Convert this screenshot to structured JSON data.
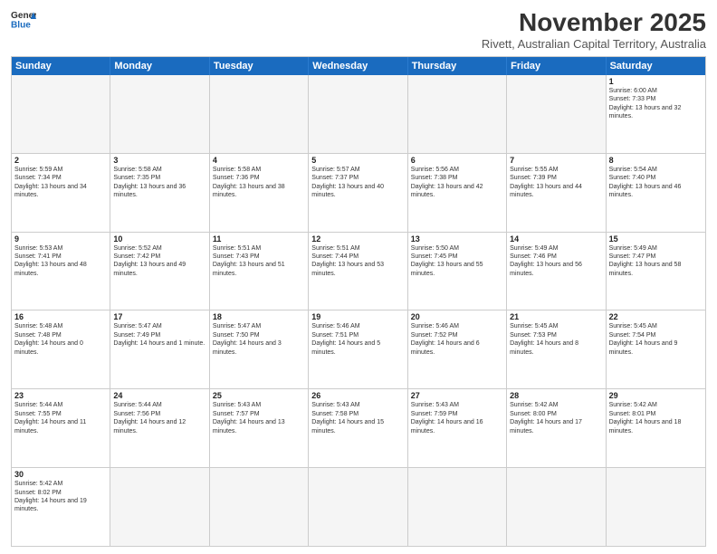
{
  "header": {
    "logo_line1": "General",
    "logo_line2": "Blue",
    "month_title": "November 2025",
    "subtitle": "Rivett, Australian Capital Territory, Australia"
  },
  "days_of_week": [
    "Sunday",
    "Monday",
    "Tuesday",
    "Wednesday",
    "Thursday",
    "Friday",
    "Saturday"
  ],
  "weeks": [
    [
      {
        "day": "",
        "empty": true
      },
      {
        "day": "",
        "empty": true
      },
      {
        "day": "",
        "empty": true
      },
      {
        "day": "",
        "empty": true
      },
      {
        "day": "",
        "empty": true
      },
      {
        "day": "",
        "empty": true
      },
      {
        "day": "1",
        "sunrise": "6:00 AM",
        "sunset": "7:33 PM",
        "daylight": "13 hours and 32 minutes."
      }
    ],
    [
      {
        "day": "2",
        "sunrise": "5:59 AM",
        "sunset": "7:34 PM",
        "daylight": "13 hours and 34 minutes."
      },
      {
        "day": "3",
        "sunrise": "5:58 AM",
        "sunset": "7:35 PM",
        "daylight": "13 hours and 36 minutes."
      },
      {
        "day": "4",
        "sunrise": "5:58 AM",
        "sunset": "7:36 PM",
        "daylight": "13 hours and 38 minutes."
      },
      {
        "day": "5",
        "sunrise": "5:57 AM",
        "sunset": "7:37 PM",
        "daylight": "13 hours and 40 minutes."
      },
      {
        "day": "6",
        "sunrise": "5:56 AM",
        "sunset": "7:38 PM",
        "daylight": "13 hours and 42 minutes."
      },
      {
        "day": "7",
        "sunrise": "5:55 AM",
        "sunset": "7:39 PM",
        "daylight": "13 hours and 44 minutes."
      },
      {
        "day": "8",
        "sunrise": "5:54 AM",
        "sunset": "7:40 PM",
        "daylight": "13 hours and 46 minutes."
      }
    ],
    [
      {
        "day": "9",
        "sunrise": "5:53 AM",
        "sunset": "7:41 PM",
        "daylight": "13 hours and 48 minutes."
      },
      {
        "day": "10",
        "sunrise": "5:52 AM",
        "sunset": "7:42 PM",
        "daylight": "13 hours and 49 minutes."
      },
      {
        "day": "11",
        "sunrise": "5:51 AM",
        "sunset": "7:43 PM",
        "daylight": "13 hours and 51 minutes."
      },
      {
        "day": "12",
        "sunrise": "5:51 AM",
        "sunset": "7:44 PM",
        "daylight": "13 hours and 53 minutes."
      },
      {
        "day": "13",
        "sunrise": "5:50 AM",
        "sunset": "7:45 PM",
        "daylight": "13 hours and 55 minutes."
      },
      {
        "day": "14",
        "sunrise": "5:49 AM",
        "sunset": "7:46 PM",
        "daylight": "13 hours and 56 minutes."
      },
      {
        "day": "15",
        "sunrise": "5:49 AM",
        "sunset": "7:47 PM",
        "daylight": "13 hours and 58 minutes."
      }
    ],
    [
      {
        "day": "16",
        "sunrise": "5:48 AM",
        "sunset": "7:48 PM",
        "daylight": "14 hours and 0 minutes."
      },
      {
        "day": "17",
        "sunrise": "5:47 AM",
        "sunset": "7:49 PM",
        "daylight": "14 hours and 1 minute."
      },
      {
        "day": "18",
        "sunrise": "5:47 AM",
        "sunset": "7:50 PM",
        "daylight": "14 hours and 3 minutes."
      },
      {
        "day": "19",
        "sunrise": "5:46 AM",
        "sunset": "7:51 PM",
        "daylight": "14 hours and 5 minutes."
      },
      {
        "day": "20",
        "sunrise": "5:46 AM",
        "sunset": "7:52 PM",
        "daylight": "14 hours and 6 minutes."
      },
      {
        "day": "21",
        "sunrise": "5:45 AM",
        "sunset": "7:53 PM",
        "daylight": "14 hours and 8 minutes."
      },
      {
        "day": "22",
        "sunrise": "5:45 AM",
        "sunset": "7:54 PM",
        "daylight": "14 hours and 9 minutes."
      }
    ],
    [
      {
        "day": "23",
        "sunrise": "5:44 AM",
        "sunset": "7:55 PM",
        "daylight": "14 hours and 11 minutes."
      },
      {
        "day": "24",
        "sunrise": "5:44 AM",
        "sunset": "7:56 PM",
        "daylight": "14 hours and 12 minutes."
      },
      {
        "day": "25",
        "sunrise": "5:43 AM",
        "sunset": "7:57 PM",
        "daylight": "14 hours and 13 minutes."
      },
      {
        "day": "26",
        "sunrise": "5:43 AM",
        "sunset": "7:58 PM",
        "daylight": "14 hours and 15 minutes."
      },
      {
        "day": "27",
        "sunrise": "5:43 AM",
        "sunset": "7:59 PM",
        "daylight": "14 hours and 16 minutes."
      },
      {
        "day": "28",
        "sunrise": "5:42 AM",
        "sunset": "8:00 PM",
        "daylight": "14 hours and 17 minutes."
      },
      {
        "day": "29",
        "sunrise": "5:42 AM",
        "sunset": "8:01 PM",
        "daylight": "14 hours and 18 minutes."
      }
    ],
    [
      {
        "day": "30",
        "sunrise": "5:42 AM",
        "sunset": "8:02 PM",
        "daylight": "14 hours and 19 minutes."
      },
      {
        "day": "",
        "empty": true
      },
      {
        "day": "",
        "empty": true
      },
      {
        "day": "",
        "empty": true
      },
      {
        "day": "",
        "empty": true
      },
      {
        "day": "",
        "empty": true
      },
      {
        "day": "",
        "empty": true
      }
    ]
  ]
}
